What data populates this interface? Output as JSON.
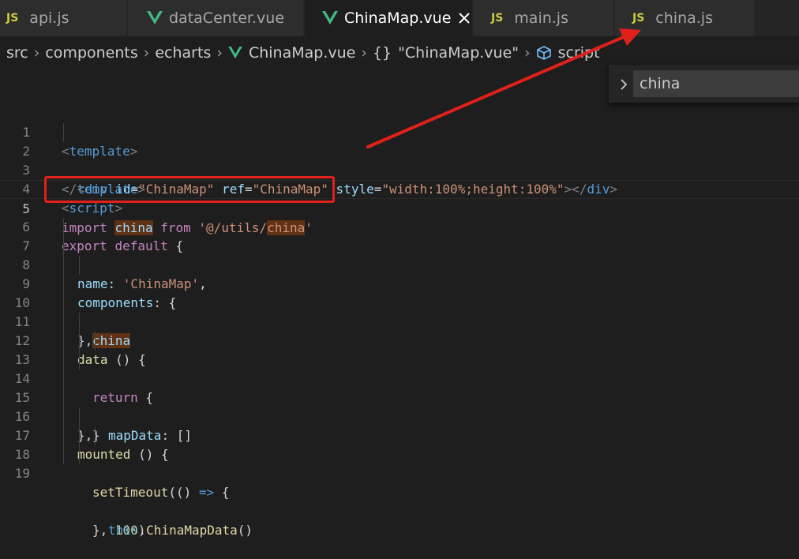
{
  "tabs": [
    {
      "label": "api.js",
      "icon": "JS"
    },
    {
      "label": "dataCenter.vue"
    },
    {
      "label": "ChinaMap.vue",
      "active": true
    },
    {
      "label": "main.js",
      "icon": "JS"
    },
    {
      "label": "china.js",
      "icon": "JS"
    }
  ],
  "breadcrumb": [
    "src",
    "components",
    "echarts",
    "ChinaMap.vue",
    "\"ChinaMap.vue\"",
    "script"
  ],
  "breadcrumb_icons": {
    "object": "{}"
  },
  "suggest": {
    "value": "china"
  },
  "colors": {
    "annotation": "#e0201a",
    "vue": "#41b883",
    "js": "#cbcb41"
  },
  "code": {
    "l1": {
      "a": "<",
      "b": "template",
      "c": ">"
    },
    "l2": {
      "a": "<",
      "b": "div",
      "c": " id",
      "d": "=",
      "e": "\"ChinaMap\"",
      "f": " ref",
      "g": "=",
      "h": "\"ChinaMap\"",
      "i": " style",
      "j": "=",
      "k": "\"width:100%;height:100%\"",
      "l": "></",
      "m": "div",
      "n": ">"
    },
    "l3": {
      "a": "</",
      "b": "template",
      "c": ">"
    },
    "l4": {
      "a": "<",
      "b": "script",
      "c": ">"
    },
    "l5": {
      "a": "import",
      "b": " ",
      "c": "china",
      "d": " ",
      "e": "from",
      "f": " '@/utils/",
      "g": "china",
      "h": "'"
    },
    "l6": {
      "a": "export",
      "b": " ",
      "c": "default",
      "d": " {"
    },
    "l7": {
      "a": "name",
      "b": ": ",
      "c": "'ChinaMap'",
      "d": ","
    },
    "l8": {
      "a": "components",
      "b": ": {"
    },
    "l9": {
      "a": "china"
    },
    "l10": {
      "a": "},"
    },
    "l11": {
      "a": "data",
      "b": " () {"
    },
    "l12": {
      "a": "return",
      "b": " {"
    },
    "l13": {
      "a": "mapData",
      "b": ": []"
    },
    "l14": {
      "a": "}"
    },
    "l15": {
      "a": "},"
    },
    "l16": {
      "a": "mounted",
      "b": " () {"
    },
    "l17": {
      "a": "setTimeout",
      "b": "(() ",
      "c": "=>",
      "d": " {"
    },
    "l18": {
      "a": "this",
      "b": ".",
      "c": "ChinaMapData",
      "d": "()"
    },
    "l19": {
      "a": "}, ",
      "b": "100",
      "c": ")"
    }
  }
}
